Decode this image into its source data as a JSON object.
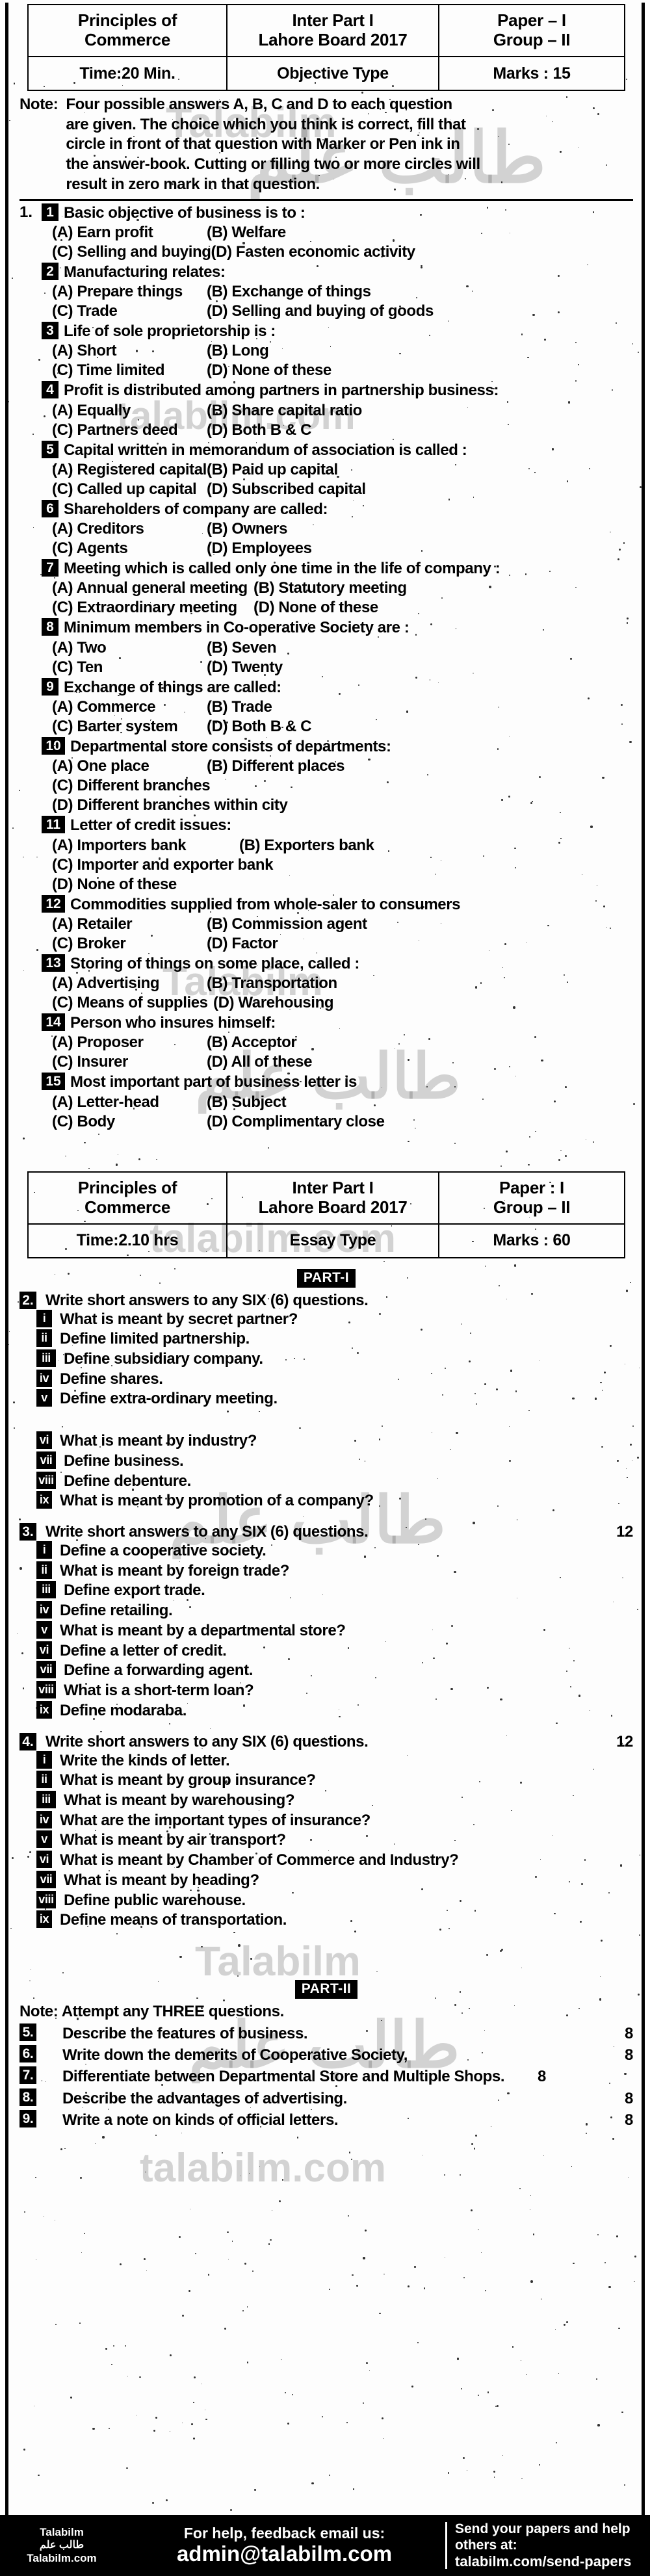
{
  "objective": {
    "header": {
      "subject_line1": "Principles of",
      "subject_line2": "Commerce",
      "exam_line1": "Inter Part I",
      "exam_line2": "Lahore Board 2017",
      "paper_line1": "Paper – I",
      "paper_line2": "Group – II",
      "time": "Time:20 Min.",
      "type": "Objective Type",
      "marks": "Marks : 15"
    },
    "note_label": "Note:",
    "note_lines": [
      "Four possible answers A, B, C and D to each question",
      "are given. The choice which you think is correct, fill that",
      "circle in front of that question with Marker or Pen ink in",
      "the answer-book. Cutting or filling two or more circles will",
      "result in zero mark in that question."
    ],
    "question_label": "1.",
    "questions": [
      {
        "num": "1",
        "stem": "Basic objective of business is to :",
        "options": [
          "(A) Earn profit",
          "(B) Welfare",
          "(C) Selling and buying",
          "(D) Fasten economic activity"
        ]
      },
      {
        "num": "2",
        "stem": "Manufacturing relates:",
        "options": [
          "(A) Prepare things",
          "(B) Exchange of things",
          "(C) Trade",
          "(D) Selling and buying of goods"
        ]
      },
      {
        "num": "3",
        "stem": "Life of sole proprietorship is :",
        "options": [
          "(A) Short",
          "(B) Long",
          "(C) Time limited",
          "(D) None of these"
        ]
      },
      {
        "num": "4",
        "stem": "Profit is distributed among partners in partnership business:",
        "options": [
          "(A) Equally",
          "(B) Share capital ratio",
          "(C) Partners deed",
          "(D) Both B & C"
        ]
      },
      {
        "num": "5",
        "stem": "Capital written in memorandum of association is called :",
        "options": [
          "(A) Registered capital",
          "(B) Paid up capital",
          "(C) Called up capital",
          "(D) Subscribed capital"
        ]
      },
      {
        "num": "6",
        "stem": "Shareholders of company are called:",
        "options": [
          "(A) Creditors",
          "(B) Owners",
          "(C) Agents",
          "(D) Employees"
        ]
      },
      {
        "num": "7",
        "stem": "Meeting which is called only one time in the life of company :",
        "options": [
          "(A) Annual general meeting",
          "(B) Statutory meeting",
          "(C) Extraordinary meeting",
          "(D) None of these"
        ]
      },
      {
        "num": "8",
        "stem": "Minimum members in Co-operative Society are :",
        "options": [
          "(A) Two",
          "(B) Seven",
          "(C) Ten",
          "(D) Twenty"
        ]
      },
      {
        "num": "9",
        "stem": "Exchange of things are called:",
        "options": [
          "(A) Commerce",
          "(B) Trade",
          "(C) Barter system",
          "(D) Both B & C"
        ]
      },
      {
        "num": "10",
        "stem": "Departmental store consists of departments:",
        "options": [
          "(A) One place",
          "(B) Different places",
          "(C) Different branches",
          "(D) Different branches within city"
        ]
      },
      {
        "num": "11",
        "stem": "Letter of credit issues:",
        "options": [
          "(A) Importers bank",
          "(B) Exporters bank",
          "(C) Importer and exporter bank",
          "(D) None of these"
        ]
      },
      {
        "num": "12",
        "stem": "Commodities supplied from whole-saler to consumers",
        "options": [
          "(A) Retailer",
          "(B) Commission agent",
          "(C) Broker",
          "(D) Factor"
        ]
      },
      {
        "num": "13",
        "stem": "Storing of things on some place, called :",
        "options": [
          "(A) Advertising",
          "(B) Transportation",
          "(C) Means of supplies",
          "(D) Warehousing"
        ]
      },
      {
        "num": "14",
        "stem": "Person who insures himself:",
        "options": [
          "(A) Proposer",
          "(B) Acceptor",
          "(C) Insurer",
          "(D) All of these"
        ]
      },
      {
        "num": "15",
        "stem": "Most important part of business letter is",
        "options": [
          "(A) Letter-head",
          "(B) Subject",
          "(C) Body",
          "(D) Complimentary close"
        ]
      }
    ]
  },
  "subjective": {
    "header": {
      "subject_line1": "Principles of",
      "subject_line2": "Commerce",
      "exam_line1": "Inter Part I",
      "exam_line2": "Lahore Board 2017",
      "paper_line1": "Paper : I",
      "paper_line2": "Group – II",
      "time": "Time:2.10 hrs",
      "type": "Essay Type",
      "marks": "Marks : 60"
    },
    "part1_badge": "PART-I",
    "part2_badge": "PART-II",
    "groups": [
      {
        "num": "2.",
        "title": "Write short answers to any SIX (6) questions.",
        "marks": "",
        "items": [
          {
            "roman": "i",
            "text": "What is meant by secret partner?"
          },
          {
            "roman": "ii",
            "text": "Define limited partnership."
          },
          {
            "roman": "iii",
            "text": "Define subsidiary company."
          },
          {
            "roman": "iv",
            "text": "Define shares."
          },
          {
            "roman": "v",
            "text": "Define extra-ordinary meeting."
          },
          {
            "roman": "vi",
            "text": "What is meant by industry?"
          },
          {
            "roman": "vii",
            "text": "Define business."
          },
          {
            "roman": "viii",
            "text": "Define debenture."
          },
          {
            "roman": "ix",
            "text": "What is meant by promotion of a company?"
          }
        ]
      },
      {
        "num": "3.",
        "title": "Write short answers to any SIX (6) questions.",
        "marks": "12",
        "items": [
          {
            "roman": "i",
            "text": "Define a cooperative society."
          },
          {
            "roman": "ii",
            "text": "What is meant by foreign trade?"
          },
          {
            "roman": "iii",
            "text": "Define export trade."
          },
          {
            "roman": "iv",
            "text": "Define retailing."
          },
          {
            "roman": "v",
            "text": "What is meant by a departmental store?"
          },
          {
            "roman": "vi",
            "text": "Define a letter of credit."
          },
          {
            "roman": "vii",
            "text": "Define a forwarding agent."
          },
          {
            "roman": "viii",
            "text": "What is a short-term loan?"
          },
          {
            "roman": "ix",
            "text": "Define modaraba."
          }
        ]
      },
      {
        "num": "4.",
        "title": "Write short answers to any SIX (6) questions.",
        "marks": "12",
        "items": [
          {
            "roman": "i",
            "text": "Write the kinds of letter."
          },
          {
            "roman": "ii",
            "text": "What is meant by group insurance?"
          },
          {
            "roman": "iii",
            "text": "What is meant by warehousing?"
          },
          {
            "roman": "iv",
            "text": "What are the important types of insurance?"
          },
          {
            "roman": "v",
            "text": "What is meant by air transport?"
          },
          {
            "roman": "vi",
            "text": "What is meant by Chamber of Commerce and Industry?"
          },
          {
            "roman": "vii",
            "text": "What is meant by heading?"
          },
          {
            "roman": "viii",
            "text": "Define public warehouse."
          },
          {
            "roman": "ix",
            "text": "Define means of transportation."
          }
        ]
      }
    ],
    "part2_note": "Note: Attempt any THREE questions.",
    "part2_items": [
      {
        "num": "5.",
        "text": "Describe the features of business.",
        "marks": "8"
      },
      {
        "num": "6.",
        "text": "Write down the demerits of Cooperative Society,",
        "marks": "8"
      },
      {
        "num": "7.",
        "text": "Differentiate between Departmental Store and Multiple Shops.",
        "marks": "8"
      },
      {
        "num": "8.",
        "text": "Describe the advantages of advertising.",
        "marks": "8"
      },
      {
        "num": "9.",
        "text": "Write a note on kinds of official letters.",
        "marks": "8"
      }
    ]
  },
  "footer": {
    "brand_top": "Talabilm",
    "brand_urdu": "طالب علم",
    "brand_bottom": "Talabilm.com",
    "help_line1": "For help, feedback email us:",
    "help_email": "admin@talabilm.com",
    "send_line1": "Send your papers and help",
    "send_line2": "others at:",
    "send_url": "talabilm.com/send-papers"
  },
  "watermarks": {
    "w1": "Talabilm",
    "w2": "talabilm.com",
    "w3": "طالب علم"
  }
}
